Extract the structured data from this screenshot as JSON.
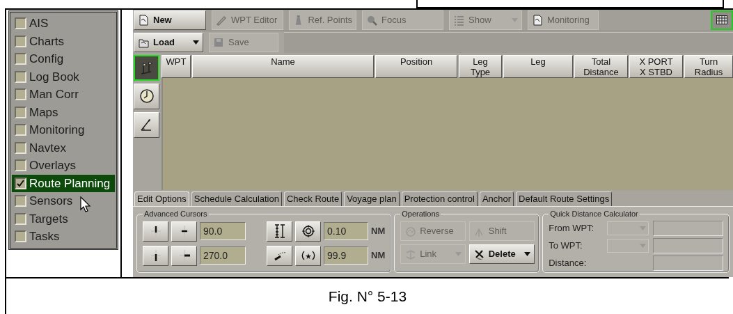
{
  "sidebar": {
    "items": [
      {
        "label": "AIS",
        "checked": false,
        "selected": false
      },
      {
        "label": "Charts",
        "checked": false,
        "selected": false
      },
      {
        "label": "Config",
        "checked": false,
        "selected": false
      },
      {
        "label": "Log Book",
        "checked": false,
        "selected": false
      },
      {
        "label": "Man Corr",
        "checked": false,
        "selected": false
      },
      {
        "label": "Maps",
        "checked": false,
        "selected": false
      },
      {
        "label": "Monitoring",
        "checked": false,
        "selected": false
      },
      {
        "label": "Navtex",
        "checked": false,
        "selected": false
      },
      {
        "label": "Overlays",
        "checked": false,
        "selected": false
      },
      {
        "label": "Route Planning",
        "checked": true,
        "selected": true
      },
      {
        "label": "Sensors",
        "checked": false,
        "selected": false
      },
      {
        "label": "Targets",
        "checked": false,
        "selected": false
      },
      {
        "label": "Tasks",
        "checked": false,
        "selected": false
      }
    ]
  },
  "toolbar": {
    "row_1": [
      {
        "label": "New",
        "disabled": false,
        "kind": "plain"
      },
      {
        "label": "WPT Editor",
        "disabled": true,
        "kind": "plain"
      },
      {
        "label": "Ref. Points",
        "disabled": true,
        "kind": "plain"
      },
      {
        "label": "Focus",
        "disabled": true,
        "kind": "plain"
      },
      {
        "label": "Show",
        "disabled": true,
        "kind": "dropdown"
      },
      {
        "label": "Monitoring",
        "disabled": true,
        "kind": "plain"
      }
    ],
    "grid_button": {
      "selected": true
    },
    "row_2": [
      {
        "label": "Load",
        "disabled": false,
        "kind": "dropdown"
      },
      {
        "label": "Save",
        "disabled": true,
        "kind": "plain"
      }
    ]
  },
  "side_tools": [
    {
      "selected": true
    },
    {
      "selected": false
    },
    {
      "selected": false
    }
  ],
  "table": {
    "columns": [
      "WPT",
      "Name",
      "Position",
      "Leg\nType",
      "Leg",
      "Total\nDistance",
      "X PORT\nX STBD",
      "Turn\nRadius"
    ]
  },
  "tabs": [
    {
      "label": "Edit Options",
      "selected": true
    },
    {
      "label": "Schedule Calculation",
      "selected": false
    },
    {
      "label": "Check Route",
      "selected": false
    },
    {
      "label": "Voyage plan",
      "selected": false
    },
    {
      "label": "Protection control",
      "selected": false
    },
    {
      "label": "Anchor",
      "selected": false
    },
    {
      "label": "Default Route Settings",
      "selected": false
    }
  ],
  "advanced_cursors": {
    "title": "Advanced Cursors",
    "bearings": [
      "90.0",
      "270.0"
    ],
    "ranges": [
      {
        "value": "0.10",
        "unit": "NM"
      },
      {
        "value": "99.9",
        "unit": "NM"
      }
    ]
  },
  "operations": {
    "title": "Operations",
    "buttons": [
      {
        "label": "Reverse",
        "disabled": true,
        "kind": "plain"
      },
      {
        "label": "Shift",
        "disabled": true,
        "kind": "plain"
      },
      {
        "label": "Link",
        "disabled": true,
        "kind": "dropdown"
      },
      {
        "label": "Delete",
        "disabled": false,
        "kind": "dropdown"
      }
    ]
  },
  "quick_distance": {
    "title": "Quick Distance Calculator",
    "rows": [
      {
        "label": "From WPT:",
        "kind": "select"
      },
      {
        "label": "To WPT:",
        "kind": "select"
      },
      {
        "label": "Distance:",
        "kind": "plain"
      }
    ]
  },
  "caption": "Fig. N° 5-13"
}
